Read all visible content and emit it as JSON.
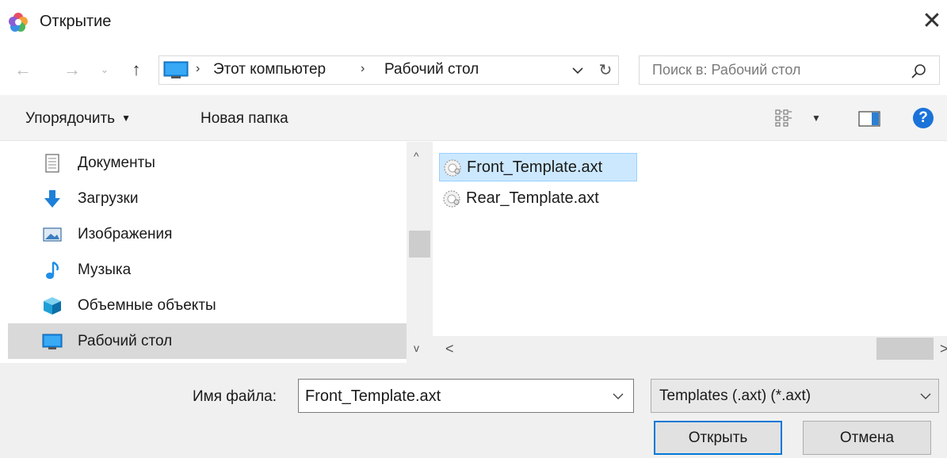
{
  "window": {
    "title": "Открытие",
    "close_glyph": "✕",
    "app_icon": "app-flower-icon"
  },
  "nav_buttons": {
    "back_glyph": "←",
    "forward_glyph": "→",
    "recent_glyph": "⌄",
    "up_glyph": "↑"
  },
  "address": {
    "icon": "computer-icon",
    "separator": "›",
    "crumbs": [
      "Этот компьютер",
      "Рабочий стол"
    ],
    "refresh_glyph": "↻"
  },
  "search": {
    "placeholder": "Поиск в: Рабочий стол",
    "icon": "search-icon"
  },
  "toolbar": {
    "organize_label": "Упорядочить",
    "organize_arrow": "▼",
    "new_folder_label": "Новая папка",
    "view_arrow": "▼",
    "help_glyph": "?"
  },
  "nav_pane": {
    "items": [
      {
        "label": "Документы",
        "icon": "documents-icon"
      },
      {
        "label": "Загрузки",
        "icon": "downloads-icon"
      },
      {
        "label": "Изображения",
        "icon": "pictures-icon"
      },
      {
        "label": "Музыка",
        "icon": "music-icon"
      },
      {
        "label": "Объемные объекты",
        "icon": "3d-objects-icon"
      },
      {
        "label": "Рабочий стол",
        "icon": "desktop-icon",
        "selected": true
      }
    ],
    "scroll_up_glyph": "^",
    "scroll_down_glyph": "v"
  },
  "files": {
    "items": [
      {
        "name": "Front_Template.axt",
        "icon": "axt-file-icon",
        "selected": true
      },
      {
        "name": "Rear_Template.axt",
        "icon": "axt-file-icon"
      }
    ],
    "scroll_left_glyph": "<",
    "scroll_right_glyph": ">"
  },
  "footer": {
    "filename_label": "Имя файла:",
    "filename_value": "Front_Template.axt",
    "filetype_value": "Templates (.axt) (*.axt)",
    "open_label": "Открыть",
    "cancel_label": "Отмена"
  },
  "colors": {
    "accent": "#0078d7",
    "selection": "#cce8ff",
    "nav_selected": "#d9d9d9",
    "help_blue": "#1a73d9"
  }
}
